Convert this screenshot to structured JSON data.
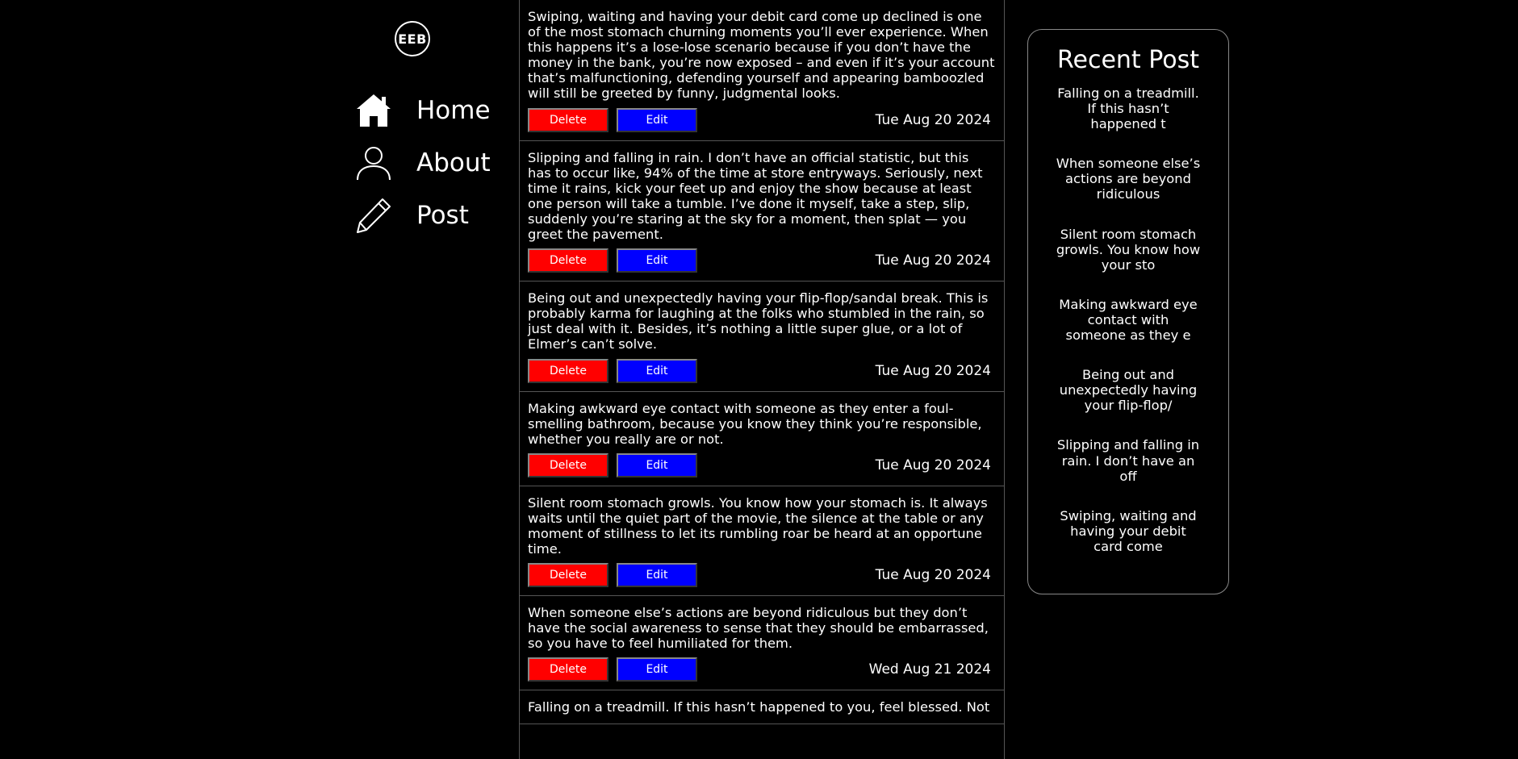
{
  "brand": {
    "logo_text": "EEB"
  },
  "nav": {
    "items": [
      {
        "label": "Home",
        "icon": "home-icon"
      },
      {
        "label": "About",
        "icon": "user-icon"
      },
      {
        "label": "Post",
        "icon": "pencil-icon"
      }
    ]
  },
  "feed": {
    "delete_label": "Delete",
    "edit_label": "Edit",
    "posts": [
      {
        "text": "Swiping, waiting and having your debit card come up declined is one of the most stomach churning moments you’ll ever experience. When this happens it’s a lose-lose scenario because if you don’t have the money in the bank, you’re now exposed – and even if it’s your account that’s malfunctioning, defending yourself and appearing bamboozled will still be greeted by funny, judgmental looks.",
        "date": "Tue Aug 20 2024"
      },
      {
        "text": "Slipping and falling in rain. I don’t have an official statistic, but this has to occur like, 94% of the time at store entryways. Seriously, next time it rains, kick your feet up and enjoy the show because at least one person will take a tumble. I’ve done it myself, take a step, slip, suddenly you’re staring at the sky for a moment, then splat — you greet the pavement.",
        "date": "Tue Aug 20 2024"
      },
      {
        "text": "Being out and unexpectedly having your flip-flop/sandal break. This is probably karma for laughing at the folks who stumbled in the rain, so just deal with it. Besides, it’s nothing a little super glue, or a lot of Elmer’s can’t solve.",
        "date": "Tue Aug 20 2024"
      },
      {
        "text": "Making awkward eye contact with someone as they enter a foul-smelling bathroom, because you know they think you’re responsible, whether you really are or not.",
        "date": "Tue Aug 20 2024"
      },
      {
        "text": "Silent room stomach growls. You know how your stomach is. It always waits until the quiet part of the movie, the silence at the table or any moment of stillness to let its rumbling roar be heard at an opportune time.",
        "date": "Tue Aug 20 2024"
      },
      {
        "text": "When someone else’s actions are beyond ridiculous but they don’t have the social awareness to sense that they should be embarrassed, so you have to feel humiliated for them.",
        "date": "Wed Aug 21 2024"
      },
      {
        "text": "Falling on a treadmill. If this hasn’t happened to you, feel blessed. Not",
        "date": ""
      }
    ]
  },
  "recent": {
    "title": "Recent Post",
    "items": [
      "Falling on a treadmill. If this hasn’t happened t",
      "When someone else’s actions are beyond ridiculous",
      "Silent room stomach growls. You know how your sto",
      "Making awkward eye contact with someone as they e",
      "Being out and unexpectedly having your flip-flop/",
      "Slipping and falling in rain. I don’t have an off",
      "Swiping, waiting and having your debit card come"
    ]
  }
}
